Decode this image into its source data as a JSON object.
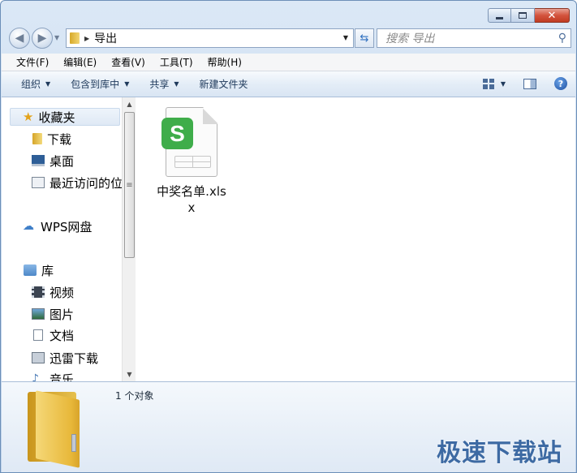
{
  "window": {
    "caption": {
      "close": "✕"
    }
  },
  "nav": {
    "address": "导出",
    "search_placeholder": "搜索 导出"
  },
  "menu": [
    "文件(F)",
    "编辑(E)",
    "查看(V)",
    "工具(T)",
    "帮助(H)"
  ],
  "toolbar": {
    "organize": "组织",
    "include_in_library": "包含到库中",
    "share": "共享",
    "new_folder": "新建文件夹",
    "help": "?"
  },
  "sidebar": {
    "favorites": "收藏夹",
    "downloads": "下载",
    "desktop": "桌面",
    "recent": "最近访问的位",
    "wps_cloud": "WPS网盘",
    "libraries": "库",
    "videos": "视频",
    "pictures": "图片",
    "documents": "文档",
    "xunlei": "迅雷下载",
    "music": "音乐"
  },
  "file": {
    "name": "中奖名单.xlsx",
    "badge": "S"
  },
  "details": {
    "count": "1 个对象"
  },
  "watermark": "极速下载站",
  "colors": {
    "wps_green": "#3fad4a",
    "close_red": "#c13b22",
    "accent_blue": "#1e395b"
  }
}
